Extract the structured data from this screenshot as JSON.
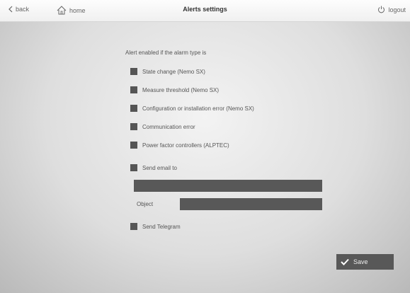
{
  "header": {
    "back_label": "back",
    "home_label": "home",
    "title": "Alerts settings",
    "logout_label": "logout"
  },
  "form": {
    "intro": "Alert enabled if the alarm type is",
    "options": [
      "State change (Nemo SX)",
      "Measure threshold (Nemo SX)",
      "Configuration or installation error (Nemo SX)",
      "Communication error",
      "Power factor controllers (ALPTEC)"
    ],
    "send_email_label": "Send email to",
    "email_value": "",
    "object_label": "Object",
    "object_value": "",
    "send_telegram_label": "Send Telegram",
    "save_label": "Save"
  }
}
